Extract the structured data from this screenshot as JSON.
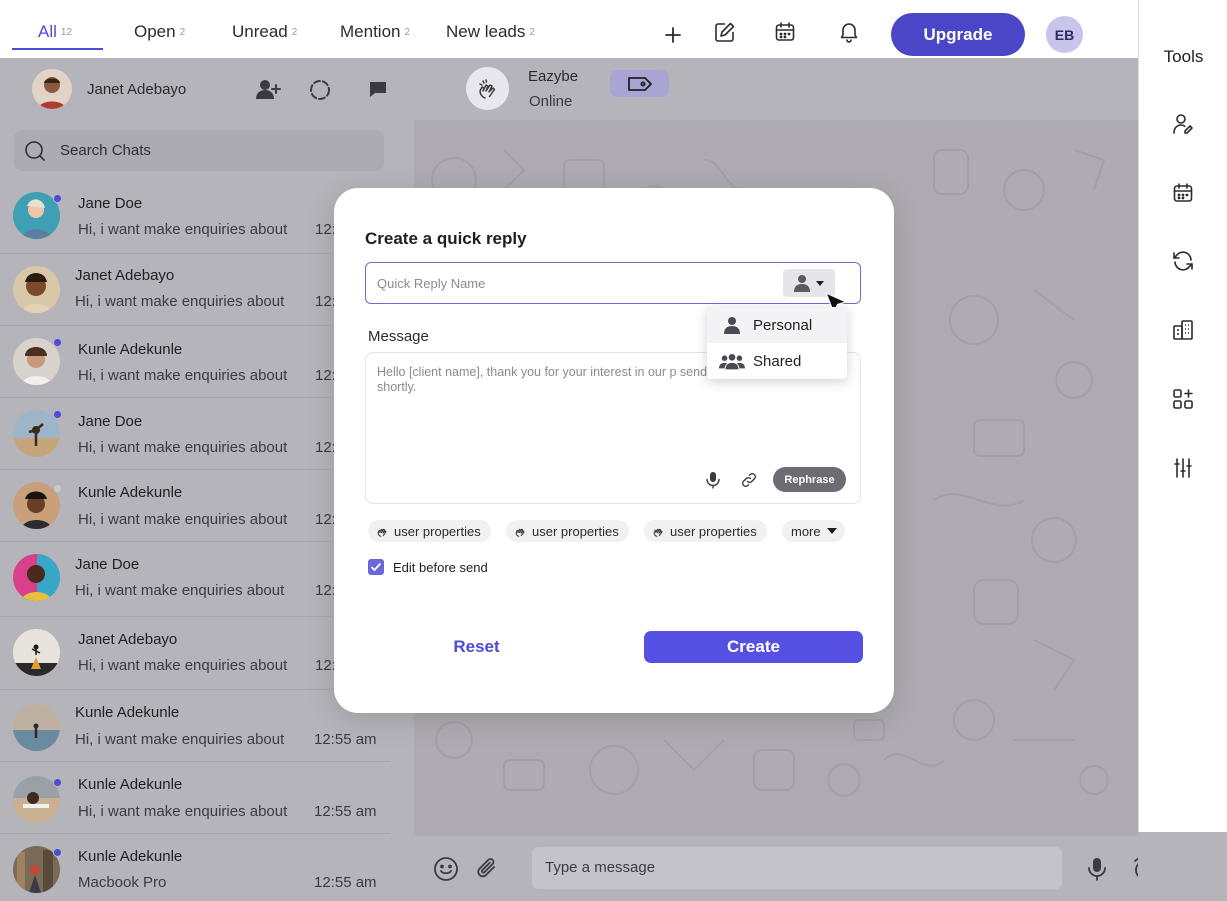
{
  "topbar": {
    "tabs": [
      {
        "label": "All",
        "count": "12",
        "active": true
      },
      {
        "label": "Open",
        "count": "2"
      },
      {
        "label": "Unread",
        "count": "2"
      },
      {
        "label": "Mention",
        "count": "2"
      },
      {
        "label": "New leads",
        "count": "2"
      }
    ],
    "icons": [
      "plus-icon",
      "edit-icon",
      "calendar-icon",
      "bell-icon"
    ],
    "upgrade_label": "Upgrade",
    "user_initials": "EB"
  },
  "header": {
    "contact_name": "Janet Adebayo",
    "actions": [
      "add-user-icon",
      "refresh-icon",
      "chat-icon"
    ],
    "bot_name": "Eazybe",
    "bot_status": "Online",
    "tag_icon": "tag-icon"
  },
  "search": {
    "placeholder": "Search Chats"
  },
  "chats": [
    {
      "name": "Jane Doe",
      "preview": "Hi, i want make enquiries about",
      "time": "12:",
      "dot": "blue"
    },
    {
      "name": "Janet Adebayo",
      "preview": "Hi, i want make enquiries about",
      "time": "12:",
      "dot": ""
    },
    {
      "name": "Kunle Adekunle",
      "preview": "Hi, i want make enquiries about",
      "time": "12:",
      "dot": "blue"
    },
    {
      "name": "Jane Doe",
      "preview": "Hi, i want make enquiries about",
      "time": "12:",
      "dot": "blue"
    },
    {
      "name": "Kunle Adekunle",
      "preview": "Hi, i want make enquiries about",
      "time": "12:",
      "dot": "grey"
    },
    {
      "name": "Jane Doe",
      "preview": "Hi, i want make enquiries about",
      "time": "12:",
      "dot": ""
    },
    {
      "name": "Janet Adebayo",
      "preview": "Hi, i want make enquiries about",
      "time": "12:",
      "dot": ""
    },
    {
      "name": "Kunle Adekunle",
      "preview": "Hi, i want make enquiries about",
      "time": "12:55 am",
      "dot": ""
    },
    {
      "name": "Kunle Adekunle",
      "preview": "Hi, i want make enquiries about",
      "time": "12:55 am",
      "dot": "blue"
    },
    {
      "name": "Kunle Adekunle",
      "preview": "Macbook Pro",
      "time": "12:55 am",
      "dot": "blue"
    }
  ],
  "composer": {
    "placeholder": "Type a message"
  },
  "tools": {
    "title": "Tools",
    "icons": [
      "contact-edit-icon",
      "calendar-icon",
      "sync-icon",
      "buildings-icon",
      "apps-add-icon",
      "sliders-icon"
    ]
  },
  "modal": {
    "title": "Create a quick reply",
    "name_placeholder": "Quick Reply Name",
    "message_label": "Message",
    "message_text": "Hello [client name], thank you for your interest in our p send you more information shortly.",
    "rephrase_label": "Rephrase",
    "chips": [
      "user properties",
      "user properties",
      "user properties"
    ],
    "more_label": "more",
    "edit_before_send_label": "Edit before send",
    "edit_before_send_checked": true,
    "reset_label": "Reset",
    "create_label": "Create"
  },
  "visibility_dropdown": {
    "options": [
      {
        "label": "Personal",
        "icon": "person-icon",
        "selected": true
      },
      {
        "label": "Shared",
        "icon": "group-icon",
        "selected": false
      }
    ]
  },
  "colors": {
    "accent": "#4f4bd8",
    "upgrade": "#4b46c8",
    "create": "#5550e2",
    "overlay": "#b6b4bb"
  }
}
